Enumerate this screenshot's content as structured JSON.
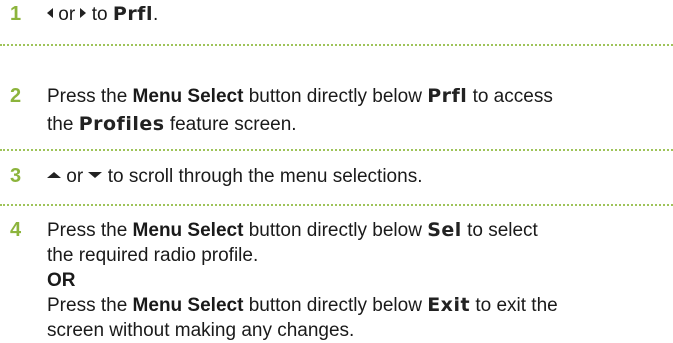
{
  "steps": [
    {
      "number": "1",
      "joiner": "or",
      "text_before_display": "to",
      "display_word": "Prfl",
      "text_after_display": ".",
      "icons": [
        "left-arrow-icon",
        "right-arrow-icon"
      ]
    },
    {
      "number": "2",
      "press": "Press the",
      "button_name": "Menu Select",
      "middle": "button directly below",
      "display_word": "Prfl",
      "after": "to access",
      "line2_pre": "the",
      "display_word_2": "Profiles",
      "line2_post": "feature screen."
    },
    {
      "number": "3",
      "joiner": "or",
      "text": "to scroll through the menu selections.",
      "icons": [
        "up-arrow-icon",
        "down-arrow-icon"
      ]
    },
    {
      "number": "4",
      "press": "Press the",
      "button_name": "Menu Select",
      "middle": "button directly below",
      "display_word": "Sel",
      "after": "to select",
      "line2": "the required radio profile.",
      "or_label": "OR",
      "alt_press": "Press the",
      "alt_button_name": "Menu Select",
      "alt_middle": "button directly below",
      "alt_display_word": "Exit",
      "alt_after": "to exit the",
      "alt_line2": "screen without making any changes."
    }
  ],
  "colors": {
    "step_number": "#8cb43c",
    "separator": "#9fc45a",
    "text": "#1a1a1a"
  }
}
